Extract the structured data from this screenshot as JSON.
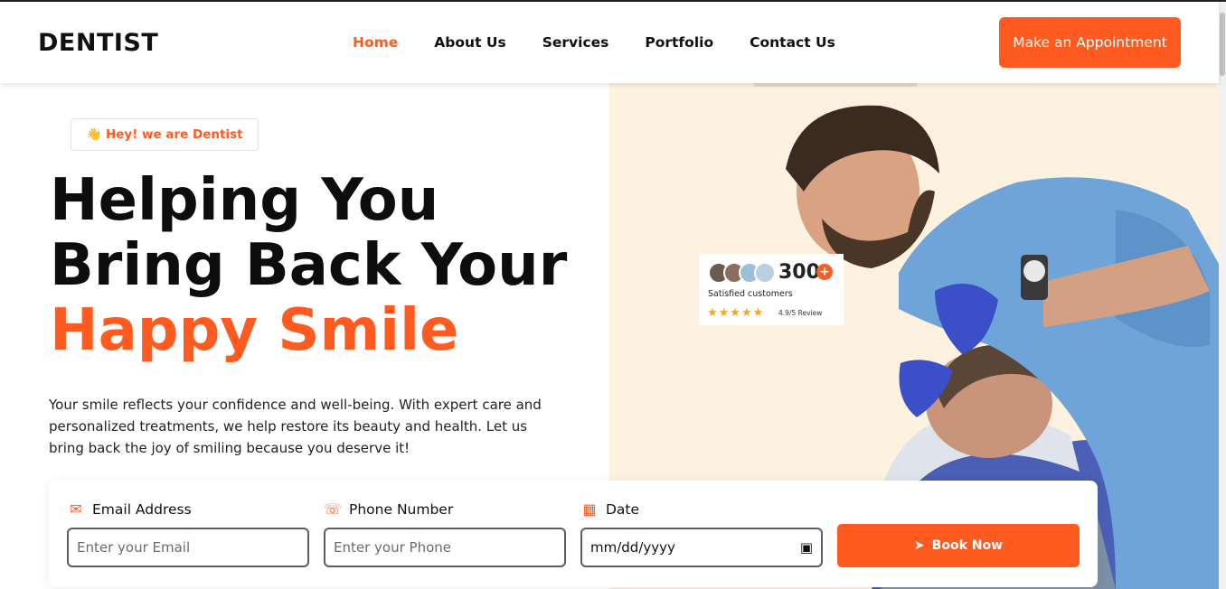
{
  "brand": {
    "logo": "DENTIST",
    "accent": "#ff5a1f"
  },
  "nav": {
    "items": [
      "Home",
      "About Us",
      "Services",
      "Portfolio",
      "Contact Us"
    ],
    "active": "Home"
  },
  "header": {
    "cta_label": "Make an Appointment"
  },
  "hero": {
    "badge": "👋 Hey! we are Dentist",
    "headline_line1": "Helping You",
    "headline_line2": "Bring Back Your",
    "headline_accent": "Happy Smile",
    "description": "Your smile reflects your confidence and well-being. With expert care and personalized treatments, we help restore its beauty and health. Let us bring back the joy of smiling because you deserve it!"
  },
  "reviews": {
    "count": "300",
    "plus": "+",
    "label": "Satisfied customers",
    "stars": "★★★★★",
    "rating": "4.9/5 Review"
  },
  "booking": {
    "email": {
      "label": "Email Address",
      "placeholder": "Enter your Email",
      "icon": "mail-icon"
    },
    "phone": {
      "label": "Phone Number",
      "placeholder": "Enter your Phone",
      "icon": "phone-icon"
    },
    "date": {
      "label": "Date",
      "value": "mm/dd/yyyy",
      "icon": "calendar-icon"
    },
    "submit_label": "Book Now"
  }
}
